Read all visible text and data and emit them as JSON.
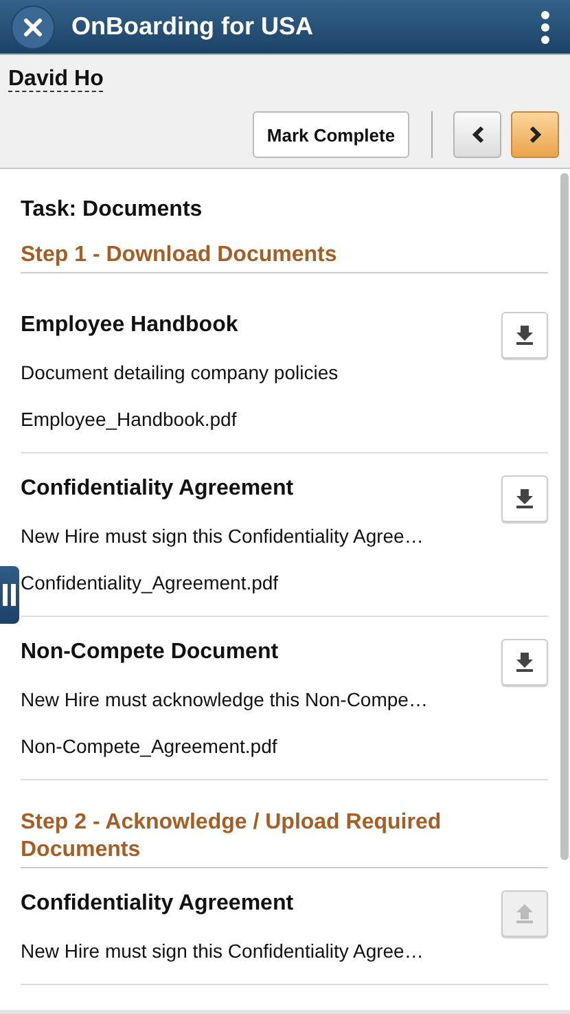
{
  "header": {
    "title": "OnBoarding for USA"
  },
  "person": {
    "name": "David Ho"
  },
  "toolbar": {
    "mark_complete": "Mark Complete"
  },
  "task_title": "Task: Documents",
  "steps": [
    {
      "title": "Step 1 - Download Documents",
      "items": [
        {
          "title": "Employee Handbook",
          "description": "Document detailing company policies",
          "file": "Employee_Handbook.pdf",
          "kind": "download",
          "disabled": false
        },
        {
          "title": "Confidentiality Agreement",
          "description": "New Hire must sign this Confidentiality Agree…",
          "file": "Confidentiality_Agreement.pdf",
          "kind": "download",
          "disabled": false
        },
        {
          "title": "Non-Compete Document",
          "description": "New Hire must acknowledge this Non-Compe…",
          "file": "Non-Compete_Agreement.pdf",
          "kind": "download",
          "disabled": false
        }
      ]
    },
    {
      "title": "Step 2 - Acknowledge / Upload Required Documents",
      "items": [
        {
          "title": "Confidentiality Agreement",
          "description": "New Hire must sign this Confidentiality Agree…",
          "kind": "upload",
          "disabled": true
        }
      ]
    }
  ]
}
